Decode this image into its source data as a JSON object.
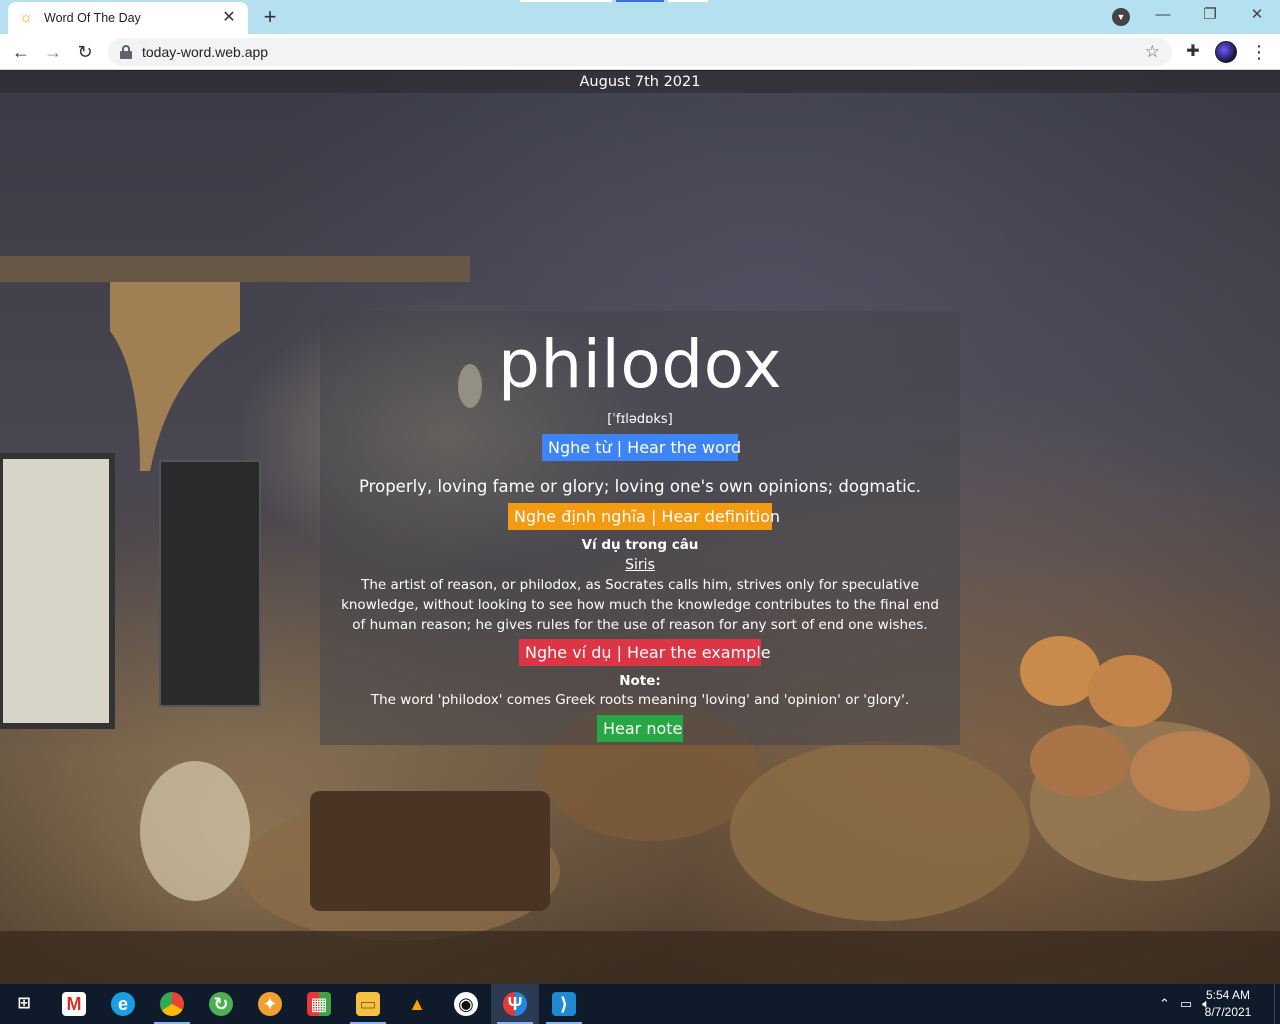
{
  "browser": {
    "tab_title": "Word Of The Day",
    "tab_close": "✕",
    "new_tab": "+",
    "url": "today-word.web.app",
    "window_minimize": "—",
    "window_restore": "❐",
    "window_close": "✕"
  },
  "page": {
    "date": "August 7th 2021",
    "word": "philodox",
    "phonetic": "[ˈfɪlədɒks]",
    "hear_word_label": "Nghe từ | Hear the word",
    "definition": "Properly, loving fame or glory; loving one's own opinions; dogmatic.",
    "hear_definition_label": "Nghe định nghĩa | Hear definition",
    "example_heading": "Ví dụ trong câu",
    "example_source": "Siris",
    "example_text": "The artist of reason, or philodox, as Socrates calls him, strives only for speculative knowledge, without looking to see how much the knowledge contributes to the final end of human reason; he gives rules for the use of reason for any sort of end one wishes.",
    "hear_example_label": "Nghe ví dụ | Hear the example",
    "note_heading": "Note:",
    "note_text": "The word 'philodox' comes Greek roots meaning 'loving' and 'opinion' or 'glory'.",
    "hear_note_label": "Hear note"
  },
  "colors": {
    "hear_word": "#3d84f5",
    "hear_definition": "#f39c12",
    "hear_example": "#dc3545",
    "hear_note": "#28a745",
    "tab_strip": "#b5e0f0"
  },
  "taskbar": {
    "apps": [
      {
        "name": "start",
        "icon": "windows-icon"
      },
      {
        "name": "gmail",
        "icon": "gmail-icon"
      },
      {
        "name": "edge",
        "icon": "edge-icon"
      },
      {
        "name": "chrome",
        "icon": "chrome-icon"
      },
      {
        "name": "app-green",
        "icon": "green-app-icon"
      },
      {
        "name": "app-chicken",
        "icon": "chicken-app-icon"
      },
      {
        "name": "app-blocks",
        "icon": "blocks-app-icon"
      },
      {
        "name": "file-explorer",
        "icon": "folder-icon"
      },
      {
        "name": "firebase",
        "icon": "firebase-icon"
      },
      {
        "name": "github",
        "icon": "github-icon"
      },
      {
        "name": "app-red-blue",
        "icon": "red-blue-app-icon"
      },
      {
        "name": "vscode",
        "icon": "vscode-icon"
      }
    ],
    "time": "5:54 AM",
    "date": "8/7/2021"
  }
}
